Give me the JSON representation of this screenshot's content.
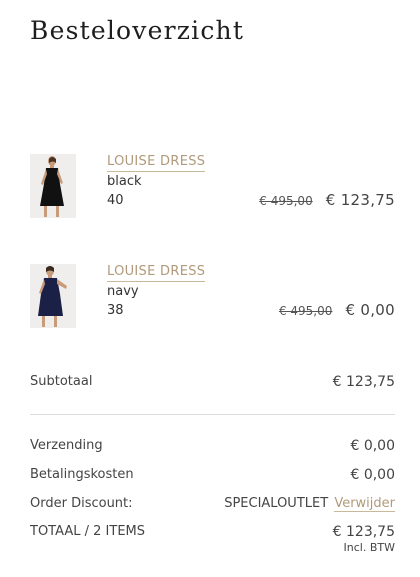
{
  "page": {
    "title": "Besteloverzicht"
  },
  "items": [
    {
      "name": "LOUISE DRESS",
      "color": "black",
      "size": "40",
      "old_price": "€ 495,00",
      "price": "€ 123,75",
      "dress_color": "#111111"
    },
    {
      "name": "LOUISE DRESS",
      "color": "navy",
      "size": "38",
      "old_price": "€ 495,00",
      "price": "€ 0,00",
      "dress_color": "#1a2046"
    }
  ],
  "summary": {
    "subtotal_label": "Subtotaal",
    "subtotal_value": "€ 123,75",
    "shipping_label": "Verzending",
    "shipping_value": "€ 0,00",
    "payment_label": "Betalingskosten",
    "payment_value": "€ 0,00",
    "discount_label": "Order Discount:",
    "discount_code": "SPECIALOUTLET",
    "discount_remove": "Verwijder",
    "total_label": "TOTAAL / 2 ITEMS",
    "total_value": "€ 123,75",
    "total_note": "Incl. BTW"
  },
  "colors": {
    "accent": "#b09a7b"
  }
}
